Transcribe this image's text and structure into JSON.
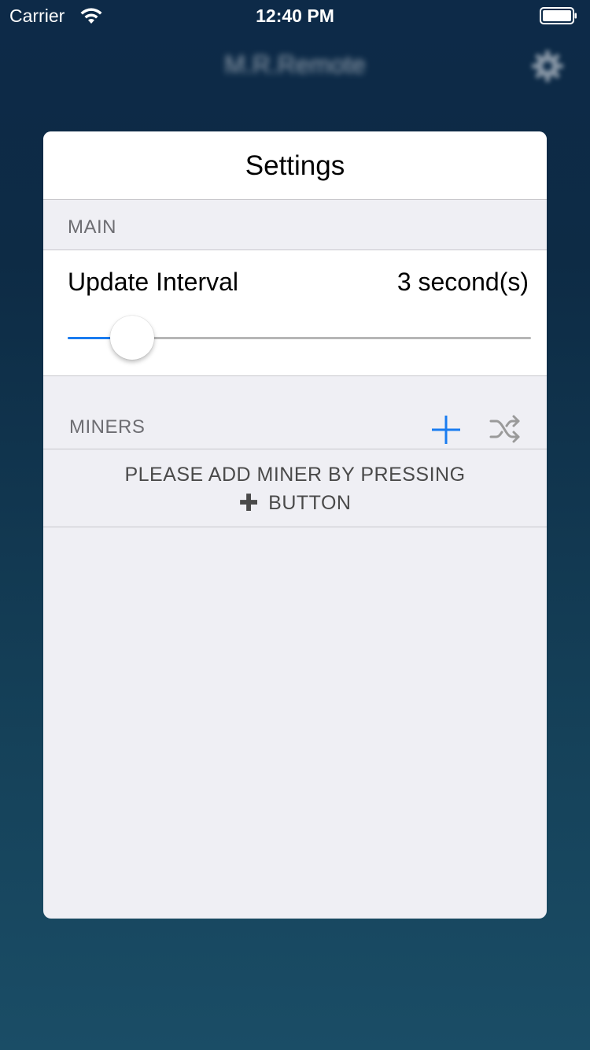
{
  "status_bar": {
    "carrier": "Carrier",
    "time": "12:40 PM",
    "wifi_icon": "wifi-icon",
    "battery_icon": "battery-icon"
  },
  "background": {
    "title": "M.R.Remote",
    "gear_icon": "gear-icon"
  },
  "settings": {
    "title": "Settings",
    "main_section": {
      "header": "MAIN",
      "update_interval": {
        "label": "Update Interval",
        "value_text": "3 second(s)",
        "slider_fraction": 0.14
      }
    },
    "miners_section": {
      "header": "MINERS",
      "add_icon": "plus-icon",
      "shuffle_icon": "shuffle-icon",
      "empty_message_line1": "PLEASE ADD MINER BY PRESSING",
      "empty_message_plus": "✚",
      "empty_message_line2": "BUTTON"
    }
  },
  "colors": {
    "accent": "#1a7cf0",
    "background_top": "#0d2a48",
    "background_bottom": "#1a4d66",
    "grouped_background": "#efeff4",
    "section_header_text": "#6d6d72"
  }
}
